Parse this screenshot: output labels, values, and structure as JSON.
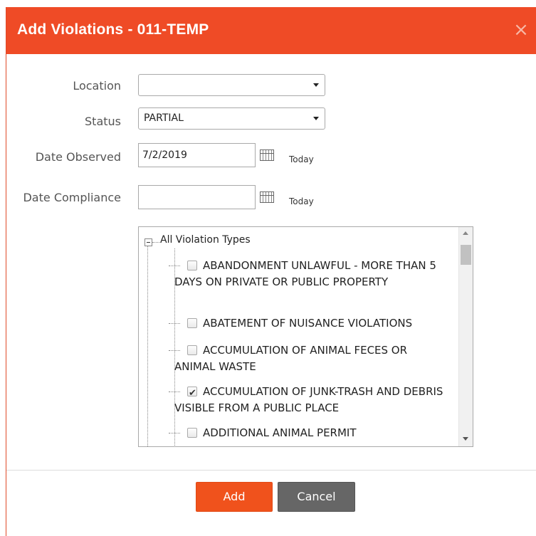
{
  "dialog": {
    "title": "Add Violations - 011-TEMP",
    "close_glyph": "×"
  },
  "form": {
    "location": {
      "label": "Location",
      "value": ""
    },
    "status": {
      "label": "Status",
      "value": "PARTIAL"
    },
    "date_observed": {
      "label": "Date Observed",
      "value": "7/2/2019",
      "today_label": "Today"
    },
    "date_compliance": {
      "label": "Date Compliance",
      "value": "",
      "today_label": "Today"
    }
  },
  "tree": {
    "root_label": "All Violation Types",
    "items": [
      {
        "text": "ABANDONMENT UNLAWFUL - MORE THAN 5 DAYS ON PRIVATE OR PUBLIC PROPERTY",
        "checked": false
      },
      {
        "text": "ABATEMENT OF NUISANCE VIOLATIONS",
        "checked": false
      },
      {
        "text": "ACCUMULATION OF ANIMAL FECES OR ANIMAL WASTE",
        "checked": false
      },
      {
        "text": "ACCUMULATION OF JUNK-TRASH AND DEBRIS VISIBLE FROM A PUBLIC PLACE",
        "checked": true
      },
      {
        "text": "ADDITIONAL ANIMAL PERMIT",
        "checked": false
      }
    ]
  },
  "buttons": {
    "add_label": "Add",
    "cancel_label": "Cancel"
  },
  "colors": {
    "header": "#ef4b26",
    "add_button": "#f0521c",
    "cancel_button": "#666666"
  },
  "icons": {
    "close": "close-icon",
    "calendar": "calendar-icon",
    "dropdown": "chevron-down-icon",
    "tree_collapse": "minus-icon"
  }
}
